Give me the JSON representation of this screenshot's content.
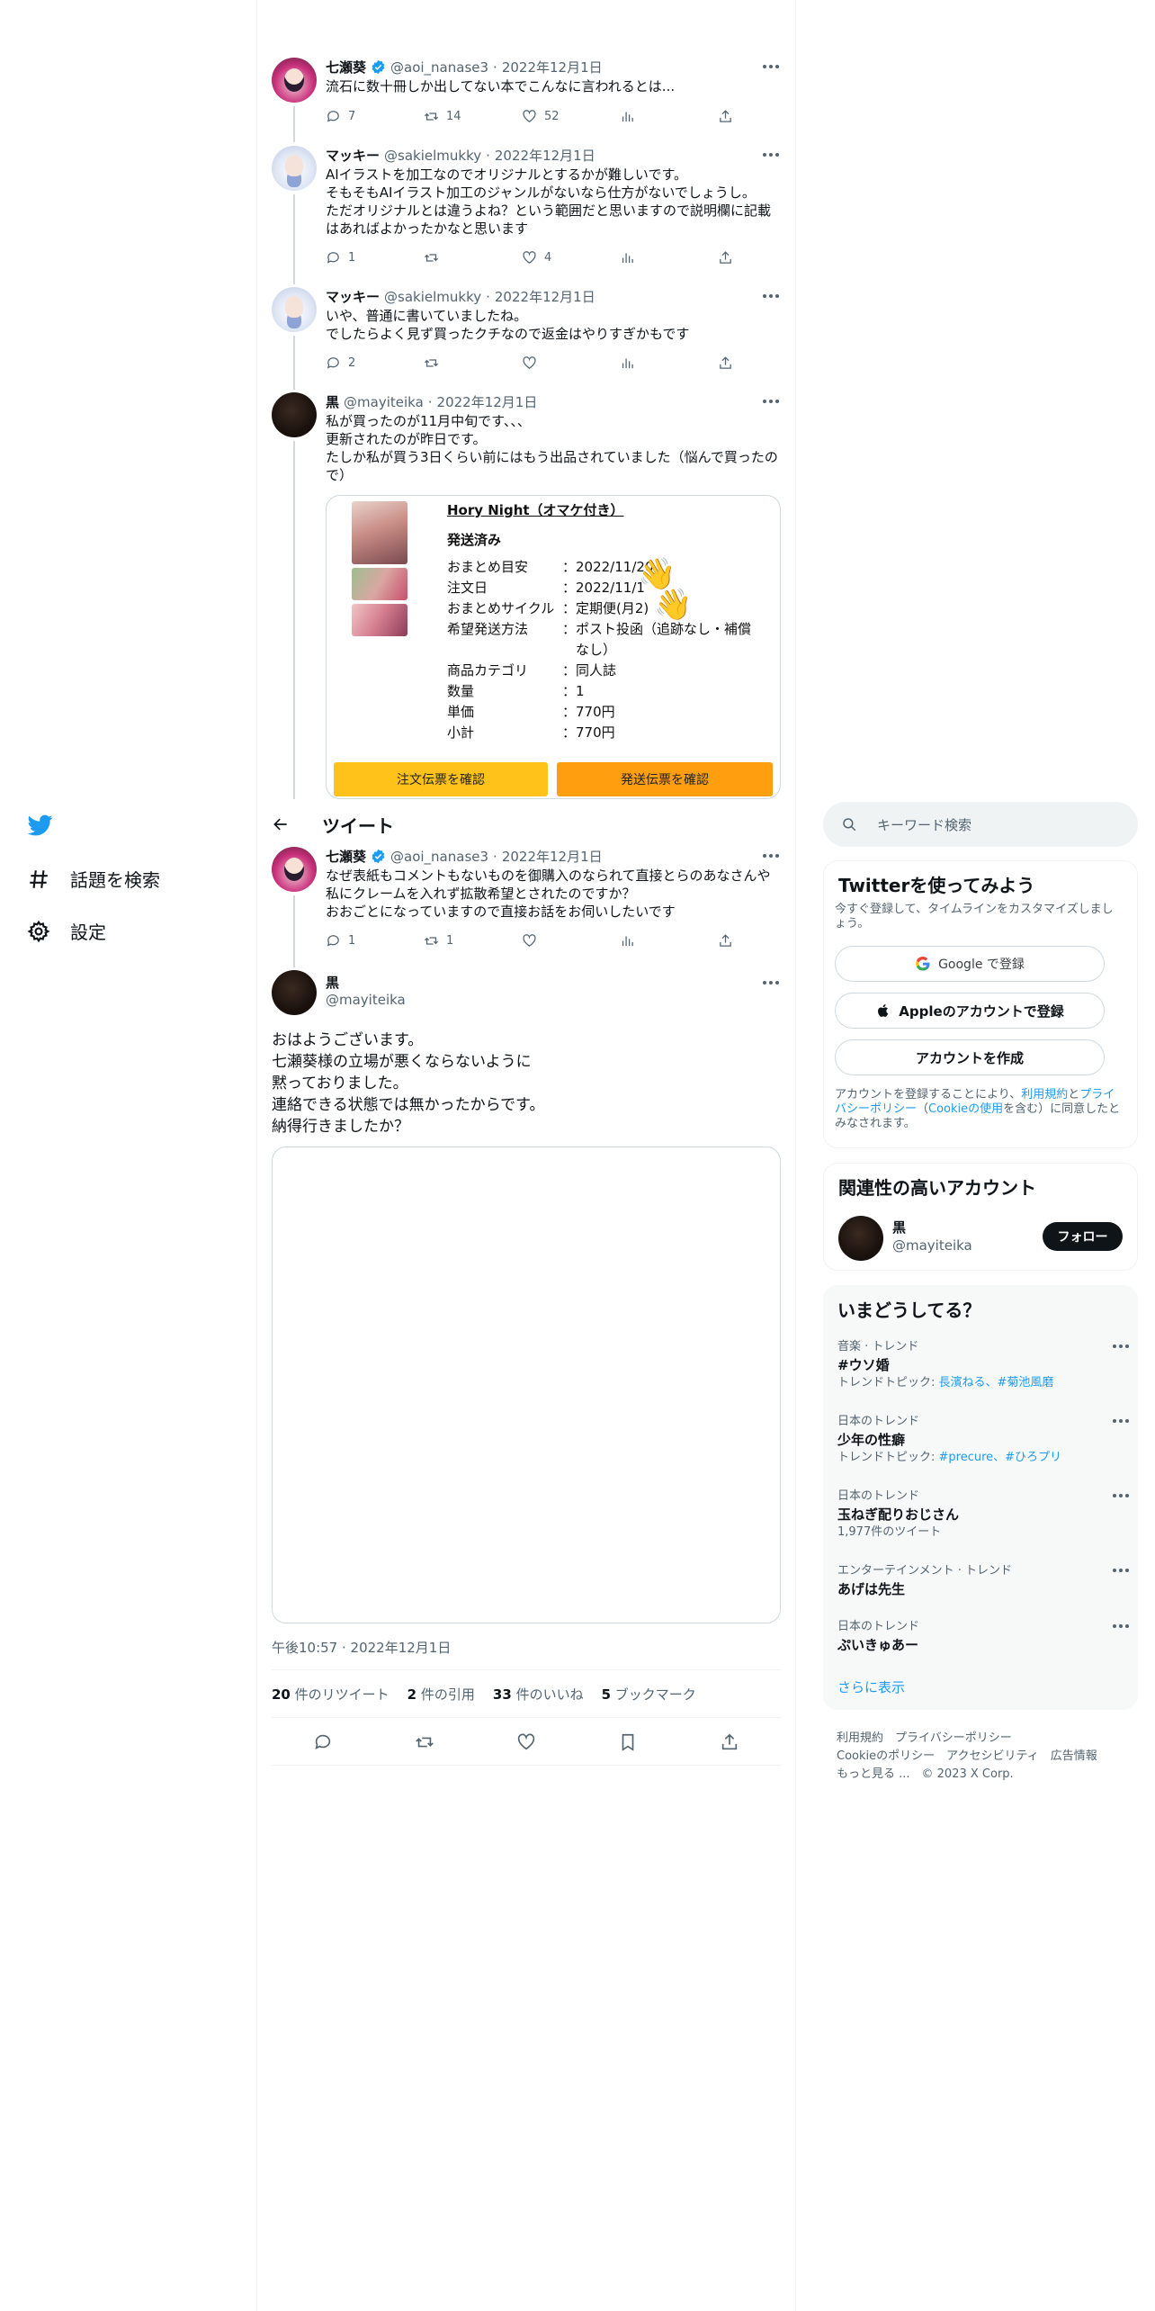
{
  "nav": {
    "explore_label": "話題を検索",
    "settings_label": "設定"
  },
  "header": {
    "title": "ツイート"
  },
  "thread": [
    {
      "name": "七瀬葵",
      "handle": "@aoi_nanase3",
      "sep": "·",
      "date": "2022年12月1日",
      "text": "流石に数十冊しか出してない本でこんなに言われるとは...",
      "replies": "7",
      "retweets": "14",
      "likes": "52"
    },
    {
      "name": "マッキー",
      "handle": "@sakielmukky",
      "sep": "·",
      "date": "2022年12月1日",
      "text": "AIイラストを加工なのでオリジナルとするかが難しいです。\nそもそもAIイラスト加工のジャンルがないなら仕方がないでしょうし。\nただオリジナルとは違うよね？という範囲だと思いますので説明欄に記載\nはあればよかったかなと思います",
      "replies": "1",
      "retweets": "",
      "likes": "4"
    },
    {
      "name": "マッキー",
      "handle": "@sakielmukky",
      "sep": "·",
      "date": "2022年12月1日",
      "text": "いや、普通に書いていましたね。\nでしたらよく見ず買ったクチなので返金はやりすぎかもです",
      "replies": "2",
      "retweets": "",
      "likes": ""
    },
    {
      "name": "黒",
      "handle": "@mayiteika",
      "sep": "·",
      "date": "2022年12月1日",
      "text": "私が買ったのが11月中旬です、、、\n更新されたのが昨日です。\nたしか私が買う3日くらい前にはもう出品されていました（悩んで買ったの\nで）"
    }
  ],
  "order": {
    "product_title": "Hory Night（オマケ付き）",
    "status": "発送済み",
    "rows": [
      {
        "k": "おまとめ目安",
        "v": "：2022/11/20"
      },
      {
        "k": "注文日",
        "v": "：2022/11/1"
      },
      {
        "k": "おまとめサイクル",
        "v": "：定期便(月2)"
      },
      {
        "k": "希望発送方法",
        "v": "：ポスト投函（追跡なし・補償"
      },
      {
        "k": "",
        "v": "　なし）"
      },
      {
        "k": "商品カテゴリ",
        "v": "：同人誌"
      },
      {
        "k": "数量",
        "v": "：1"
      },
      {
        "k": "単価",
        "v": "：770円"
      },
      {
        "k": "小計",
        "v": "：770円"
      }
    ],
    "btn_invoice": "注文伝票を確認",
    "btn_ship": "発送伝票を確認"
  },
  "quoted": {
    "name": "七瀬葵",
    "handle": "@aoi_nanase3",
    "sep": "·",
    "date": "2022年12月1日",
    "text": "なぜ表紙もコメントもないものを御購入のなられて直接とらのあなさんや\n私にクレームを入れず拡散希望とされたのですか？\nおおごとになっていますので直接お話をお伺いしたいです",
    "replies": "1",
    "retweets": "1",
    "likes": ""
  },
  "main_tweet": {
    "name": "黒",
    "handle": "@mayiteika",
    "text": "おはようございます。\n七瀬葵様の立場が悪くならないように\n黙っておりました。\n連絡できる状態では無かったからです。\n納得行きましたか？",
    "timestamp": "午後10:57 · 2022年12月1日",
    "retweets_n": "20",
    "retweets_label": "件のリツイート",
    "quotes_n": "2",
    "quotes_label": "件の引用",
    "likes_n": "33",
    "likes_label": "件のいいね",
    "bookmarks_n": "5",
    "bookmarks_label": "ブックマーク"
  },
  "search": {
    "placeholder": "キーワード検索"
  },
  "signup": {
    "title": "Twitterを使ってみよう",
    "desc": "今すぐ登録して、タイムラインをカスタマイズしましょう。",
    "google": "Google で登録",
    "apple": "Appleのアカウントで登録",
    "create": "アカウントを作成",
    "legal_1": "アカウントを登録することにより、",
    "legal_terms": "利用規約",
    "legal_2": "と",
    "legal_privacy": "プライバシーポリシー",
    "legal_3": "（",
    "legal_cookie": "Cookieの使用",
    "legal_4": "を含む）に同意したとみなされます。"
  },
  "related": {
    "title": "関連性の高いアカウント",
    "name": "黒",
    "handle": "@mayiteika",
    "follow": "フォロー"
  },
  "trends": {
    "title": "いまどうしてる？",
    "items": [
      {
        "cat": "音楽 · トレンド",
        "title": "#ウソ婚",
        "sub_prefix": "トレンドトピック: ",
        "sub_links": "長濱ねる、#菊池風磨"
      },
      {
        "cat": "日本のトレンド",
        "title": "少年の性癖",
        "sub_prefix": "トレンドトピック: ",
        "sub_links": "#precure、#ひろプリ"
      },
      {
        "cat": "日本のトレンド",
        "title": "玉ねぎ配りおじさん",
        "sub_prefix": "1,977件のツイート",
        "sub_links": ""
      },
      {
        "cat": "エンターテインメント · トレンド",
        "title": "あげは先生",
        "sub_prefix": "",
        "sub_links": ""
      },
      {
        "cat": "日本のトレンド",
        "title": "ぷいきゅあー",
        "sub_prefix": "",
        "sub_links": ""
      }
    ],
    "show_more": "さらに表示"
  },
  "footer": {
    "line1": "利用規約　プライバシーポリシー",
    "line2": "Cookieのポリシー　アクセシビリティ　広告情報",
    "line3": "もっと見る ...　© 2023 X Corp."
  }
}
